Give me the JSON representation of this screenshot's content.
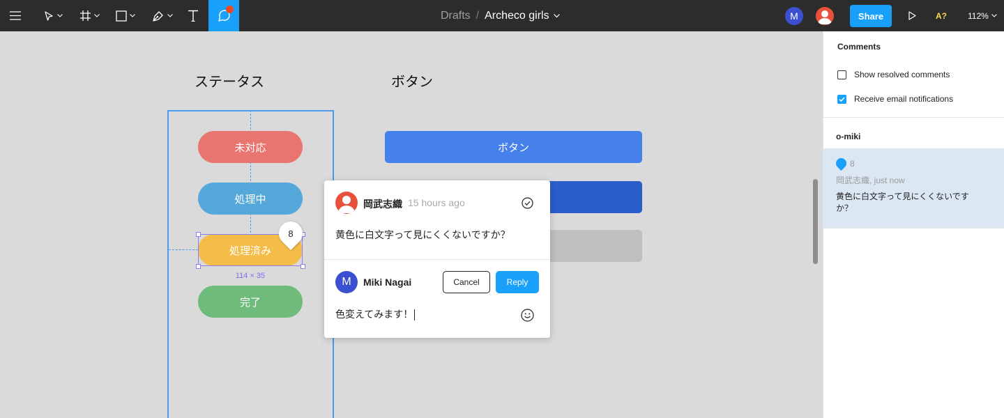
{
  "toolbar": {
    "icons": [
      "menu-icon",
      "move-tool-icon",
      "frame-tool-icon",
      "rectangle-tool-icon",
      "pen-tool-icon",
      "text-tool-icon",
      "comment-tool-icon"
    ],
    "breadcrumb": {
      "folder": "Drafts",
      "separator": "/",
      "file": "Archeco girls"
    },
    "avatar_initial": "M",
    "share_label": "Share",
    "accessibility_label": "A?",
    "zoom": "112%"
  },
  "canvas": {
    "status_heading": "ステータス",
    "button_heading": "ボタン",
    "status_pills": [
      {
        "label": "未対応",
        "color": "#e97570"
      },
      {
        "label": "処理中",
        "color": "#55a8da"
      },
      {
        "label": "処理済み",
        "color": "#f4bd49"
      },
      {
        "label": "完了",
        "color": "#6fbb7b"
      }
    ],
    "selection_size": "114 × 35",
    "pin_number": "8",
    "buttons": [
      {
        "label": "ボタン",
        "color": "#4680ea"
      },
      {
        "label": "",
        "color": "#2b5ecb"
      },
      {
        "label": "",
        "color": "#bfc1c1"
      }
    ]
  },
  "comment_popup": {
    "author": "岡武志織",
    "time": "15 hours ago",
    "message": "黄色に白文字って見にくくないですか？",
    "reply_author_initial": "M",
    "reply_author": "Miki Nagai",
    "cancel_label": "Cancel",
    "reply_label": "Reply",
    "reply_draft": "色変えてみます！"
  },
  "comments_panel": {
    "title": "Comments",
    "show_resolved_label": "Show resolved comments",
    "show_resolved_checked": false,
    "email_notifications_label": "Receive email notifications",
    "email_notifications_checked": true,
    "group": "o-miki",
    "thread": {
      "number": "8",
      "meta": "岡武志織, just now",
      "text": "黄色に白文字って見にくくないですか？"
    }
  }
}
